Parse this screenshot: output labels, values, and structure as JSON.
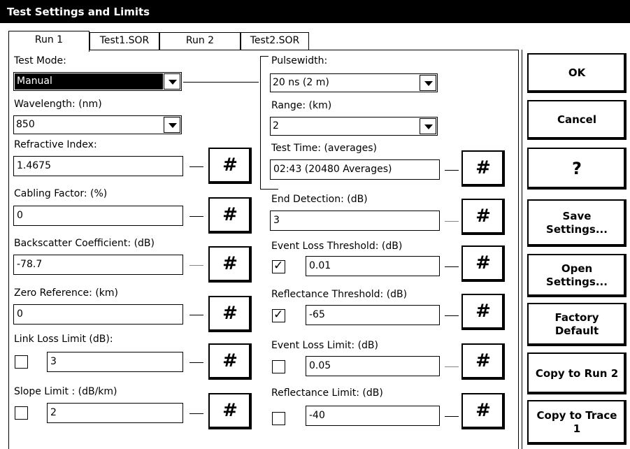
{
  "window": {
    "title": "Test Settings and Limits"
  },
  "tabs": [
    "Run 1",
    "Test1.SOR",
    "Run 2",
    "Test2.SOR"
  ],
  "left": {
    "test_mode": {
      "label": "Test Mode:",
      "value": "Manual"
    },
    "wavelength": {
      "label": "Wavelength: (nm)",
      "value": "850"
    },
    "refractive_index": {
      "label": "Refractive Index:",
      "value": "1.4675"
    },
    "cabling_factor": {
      "label": "Cabling Factor: (%)",
      "value": "0"
    },
    "backscatter": {
      "label": "Backscatter Coefficient: (dB)",
      "value": "-78.7"
    },
    "zero_reference": {
      "label": "Zero Reference: (km)",
      "value": "0"
    },
    "link_loss_limit": {
      "label": "Link Loss Limit (dB):",
      "value": "3",
      "checked": false
    },
    "slope_limit": {
      "label": "Slope Limit : (dB/km)",
      "value": "2",
      "checked": false
    }
  },
  "right": {
    "pulsewidth": {
      "label": "Pulsewidth:",
      "value": "20 ns (2 m)"
    },
    "range": {
      "label": "Range: (km)",
      "value": "2"
    },
    "test_time": {
      "label": "Test Time: (averages)",
      "value": "02:43 (20480 Averages)"
    },
    "end_detection": {
      "label": "End Detection: (dB)",
      "value": "3"
    },
    "event_loss_threshold": {
      "label": "Event Loss Threshold: (dB)",
      "value": "0.01",
      "checked": true
    },
    "reflectance_threshold": {
      "label": "Reflectance Threshold: (dB)",
      "value": "-65",
      "checked": true
    },
    "event_loss_limit": {
      "label": "Event Loss Limit: (dB)",
      "value": "0.05",
      "checked": false
    },
    "reflectance_limit": {
      "label": "Reflectance Limit: (dB)",
      "value": "-40",
      "checked": false
    }
  },
  "keypad_symbol": "#",
  "check_mark": "✓",
  "buttons": {
    "ok": "OK",
    "cancel": "Cancel",
    "help": "?",
    "save_1": "Save",
    "save_2": "Settings...",
    "open_1": "Open",
    "open_2": "Settings...",
    "factory_1": "Factory",
    "factory_2": "Default",
    "copy_run": "Copy to Run 2",
    "copy_trace_1": "Copy to Trace",
    "copy_trace_2": "1"
  }
}
